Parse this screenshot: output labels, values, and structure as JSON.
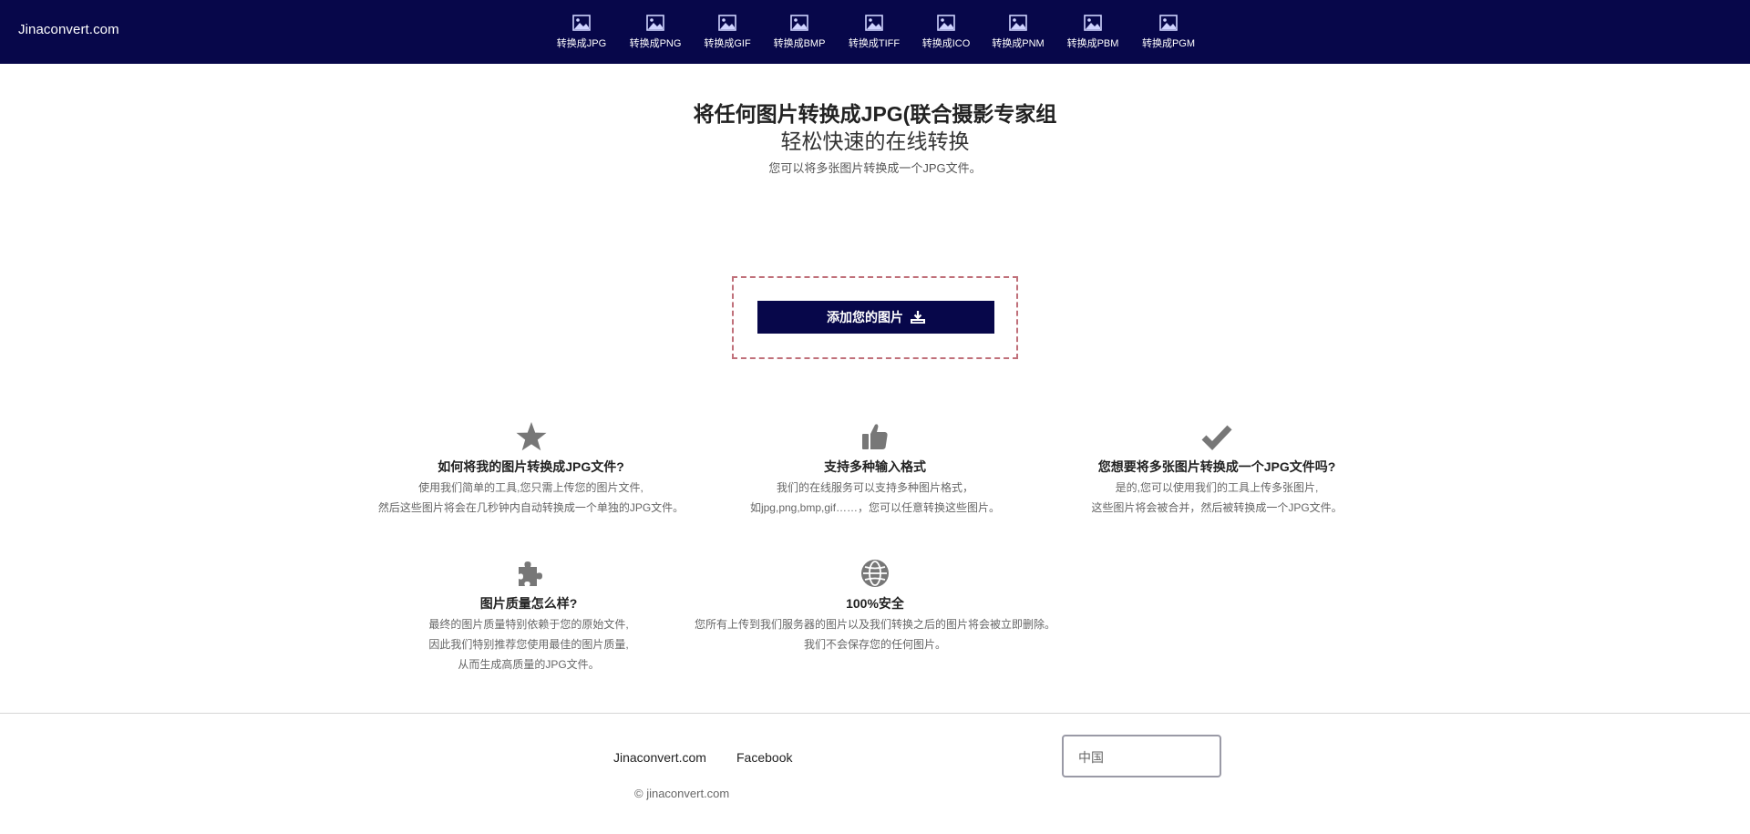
{
  "brand": "Jinaconvert.com",
  "nav": [
    {
      "label": "转换成JPG"
    },
    {
      "label": "转换成PNG"
    },
    {
      "label": "转换成GIF"
    },
    {
      "label": "转换成BMP"
    },
    {
      "label": "转换成TIFF"
    },
    {
      "label": "转换成ICO"
    },
    {
      "label": "转换成PNM"
    },
    {
      "label": "转换成PBM"
    },
    {
      "label": "转换成PGM"
    }
  ],
  "hero": {
    "title": "将任何图片转换成JPG(联合摄影专家组",
    "subtitle": "轻松快速的在线转换",
    "description": "您可以将多张图片转换成一个JPG文件。"
  },
  "upload": {
    "button_label": "添加您的图片"
  },
  "features": [
    {
      "icon": "star-icon",
      "title": "如何将我的图片转换成JPG文件?",
      "lines": [
        "使用我们简单的工具,您只需上传您的图片文件,",
        "然后这些图片将会在几秒钟内自动转换成一个单独的JPG文件。"
      ]
    },
    {
      "icon": "thumbs-up-icon",
      "title": "支持多种输入格式",
      "lines": [
        "我们的在线服务可以支持多种图片格式，",
        "如jpg,png,bmp,gif……，您可以任意转换这些图片。"
      ]
    },
    {
      "icon": "checkmark-icon",
      "title": "您想要将多张图片转换成一个JPG文件吗?",
      "lines": [
        "是的,您可以使用我们的工具上传多张图片,",
        "这些图片将会被合并，然后被转换成一个JPG文件。"
      ]
    },
    {
      "icon": "puzzle-icon",
      "title": "图片质量怎么样?",
      "lines": [
        "最终的图片质量特别依赖于您的原始文件,",
        "因此我们特别推荐您使用最佳的图片质量,",
        "从而生成高质量的JPG文件。"
      ]
    },
    {
      "icon": "globe-icon",
      "title": "100%安全",
      "lines": [
        "您所有上传到我们服务器的图片以及我们转换之后的图片将会被立即删除。",
        "我们不会保存您的任何图片。"
      ]
    }
  ],
  "footer": {
    "link1": "Jinaconvert.com",
    "link2": "Facebook",
    "copyright": "© jinaconvert.com",
    "language": "中国"
  },
  "colors": {
    "nav_bg": "#07074a",
    "button_bg": "#07074a",
    "dropzone_border": "#c0707a",
    "icon_grey": "#777777"
  }
}
